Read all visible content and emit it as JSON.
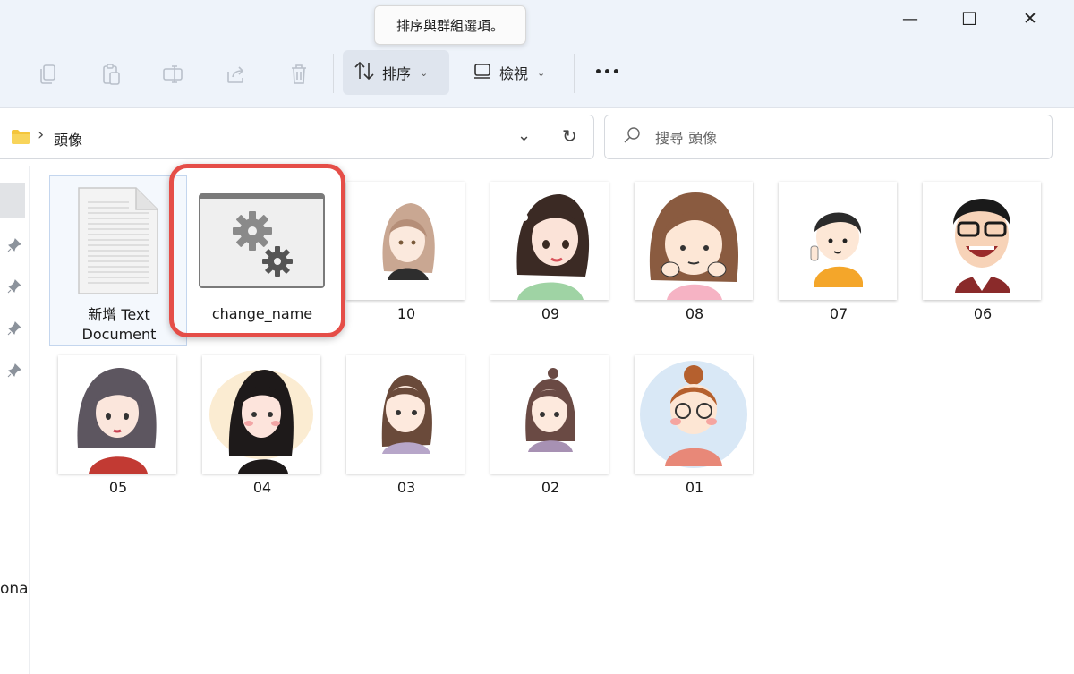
{
  "tooltip": {
    "text": "排序與群組選項。"
  },
  "toolbar": {
    "sort_label": "排序",
    "view_label": "檢視",
    "more_label": "•••"
  },
  "window": {
    "minimize": "—",
    "maximize": "☐",
    "close": "✕"
  },
  "address": {
    "folder": "頭像",
    "separator": "›"
  },
  "search": {
    "placeholder": "搜尋 頭像"
  },
  "nav": {
    "partial_label": "ona"
  },
  "files": [
    {
      "name": "新增 Text Document",
      "type": "text-document",
      "selected": true
    },
    {
      "name": "change_name",
      "type": "settings-file",
      "highlighted": true
    },
    {
      "name": "10",
      "type": "image"
    },
    {
      "name": "09",
      "type": "image"
    },
    {
      "name": "08",
      "type": "image"
    },
    {
      "name": "07",
      "type": "image"
    },
    {
      "name": "06",
      "type": "image"
    },
    {
      "name": "05",
      "type": "image"
    },
    {
      "name": "04",
      "type": "image"
    },
    {
      "name": "03",
      "type": "image"
    },
    {
      "name": "02",
      "type": "image"
    },
    {
      "name": "01",
      "type": "image"
    }
  ],
  "colors": {
    "highlight": "#e54e48",
    "toolbar_bg": "#eef3fa",
    "folder": "#f4c53b"
  }
}
